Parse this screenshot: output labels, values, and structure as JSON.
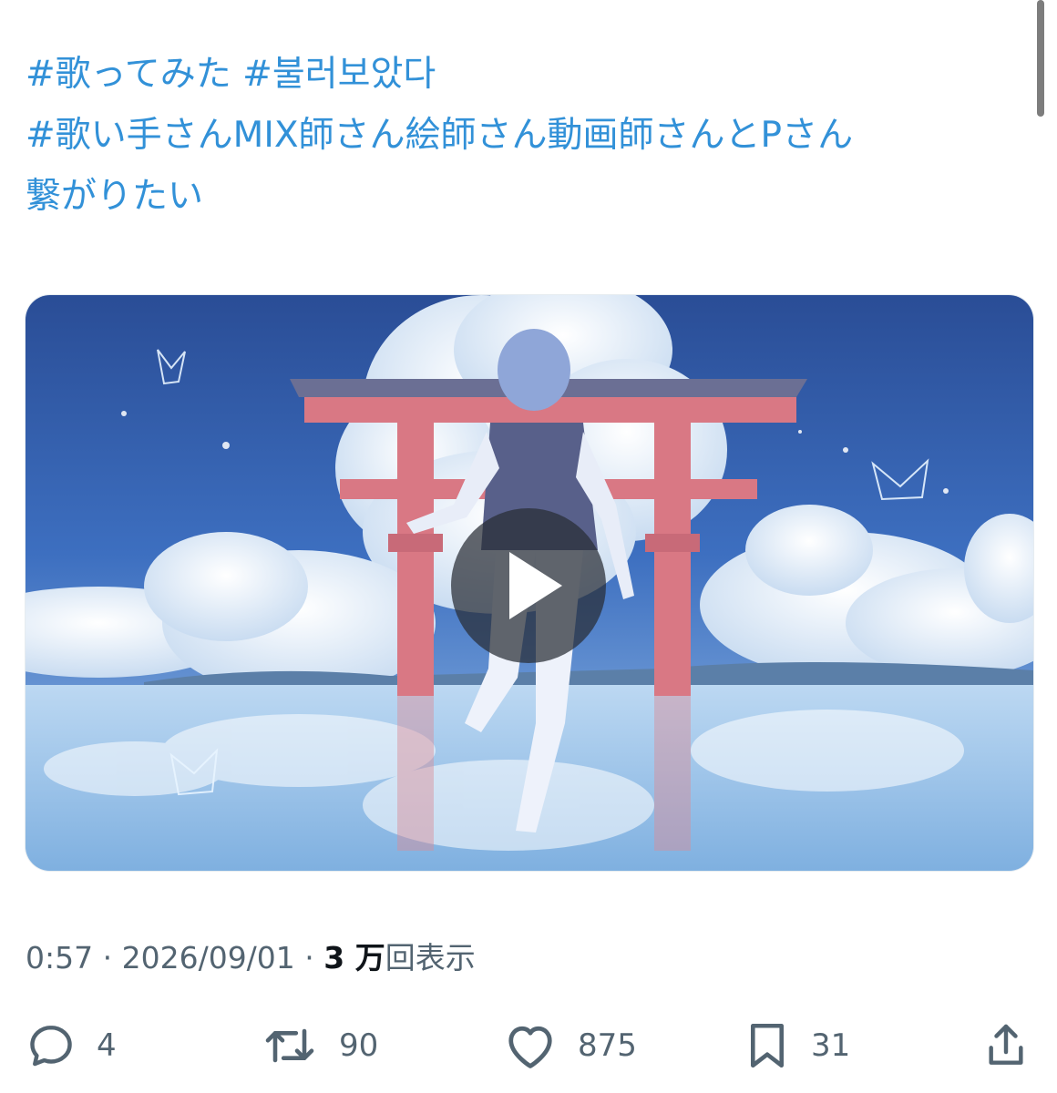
{
  "tweet": {
    "hashtags_line1": [
      "#歌ってみた",
      "#불러보았다"
    ],
    "hashtag_line2": "#歌い手さんMIX師さん絵師さん動画師さんとPさん",
    "hashtag_line2_cont": "繋がりたい"
  },
  "meta": {
    "time": "0:57",
    "separator": " · ",
    "date": "2026/09/01",
    "views_count": "3 万",
    "views_label": "回表示"
  },
  "actions": {
    "replies": "4",
    "retweets": "90",
    "likes": "875",
    "bookmarks": "31"
  },
  "colors": {
    "link": "#3291d8",
    "meta_text": "#536471",
    "emphasis": "#0f1419",
    "icon": "#536471"
  },
  "icons": {
    "reply": "reply-icon",
    "retweet": "retweet-icon",
    "like": "heart-icon",
    "bookmark": "bookmark-icon",
    "share": "share-icon",
    "play": "play-icon"
  }
}
